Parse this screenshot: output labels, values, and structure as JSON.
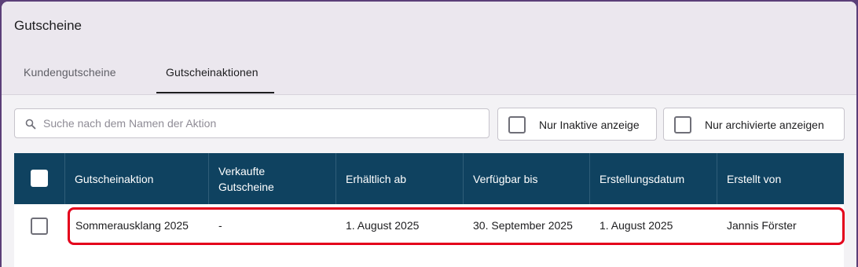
{
  "header": {
    "title": "Gutscheine",
    "tabs": [
      {
        "label": "Kundengutscheine",
        "active": false
      },
      {
        "label": "Gutscheinaktionen",
        "active": true
      }
    ]
  },
  "toolbar": {
    "search": {
      "value": "",
      "placeholder": "Suche nach dem Namen der Aktion",
      "icon": "search-icon"
    },
    "filters": [
      {
        "label": "Nur Inaktive anzeige",
        "checked": false
      },
      {
        "label": "Nur archivierte anzeigen",
        "checked": false
      }
    ]
  },
  "table": {
    "headers": {
      "campaign": "Gutscheinaktion",
      "sold_line1": "Verkaufte",
      "sold_line2": "Gutscheine",
      "available_from": "Erhältlich ab",
      "available_until": "Verfügbar bis",
      "created_date": "Erstellungsdatum",
      "created_by": "Erstellt von"
    },
    "rows": [
      {
        "campaign": "Sommerausklang 2025",
        "sold": "-",
        "available_from": "1. August 2025",
        "available_until": "30. September 2025",
        "created_date": "1. August 2025",
        "created_by": "Jannis Förster",
        "selected": false
      }
    ]
  },
  "colors": {
    "accent_header": "#0f4260",
    "highlight": "#e4001b",
    "window_frame": "#5b3f78"
  }
}
